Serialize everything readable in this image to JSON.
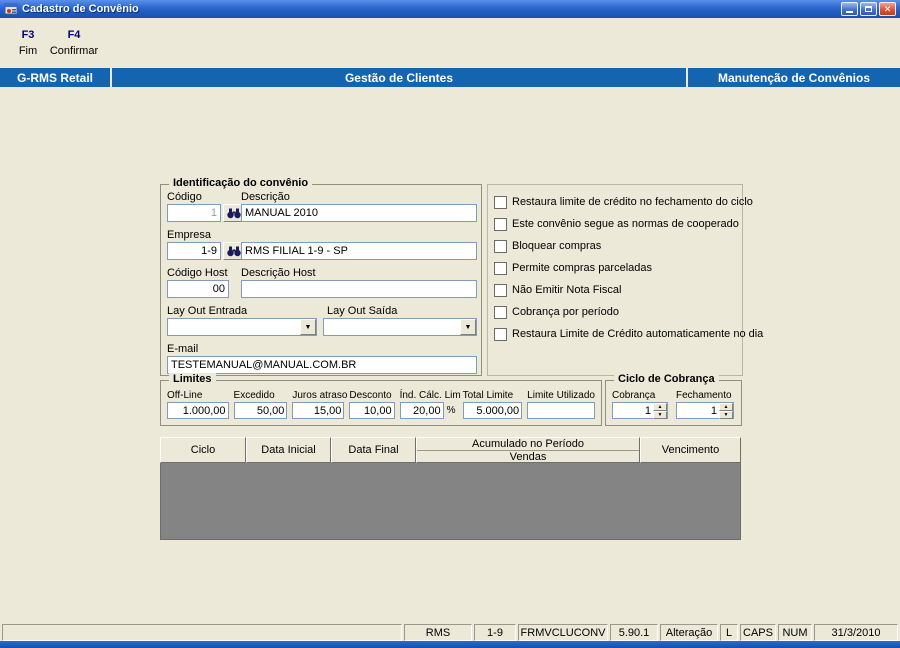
{
  "colors": {
    "header_blue": "#1464AF",
    "titlebar_blue": "#2A66CC",
    "grid_body_gray": "#848484",
    "form_bg": "#ECE9D8"
  },
  "window": {
    "title": "Cadastro de Convênio"
  },
  "toolbar": {
    "items": [
      {
        "key": "F3",
        "label": "Fim"
      },
      {
        "key": "F4",
        "label": "Confirmar"
      }
    ]
  },
  "header": {
    "left": "G-RMS Retail",
    "center": "Gestão de Clientes",
    "right": "Manutenção de Convênios"
  },
  "identification": {
    "title": "Identificação do convênio",
    "codigo": {
      "label": "Código",
      "value": "1"
    },
    "descricao": {
      "label": "Descrição",
      "value": "MANUAL 2010"
    },
    "empresa": {
      "label": "Empresa",
      "value": "1-9",
      "descricao": "RMS FILIAL 1-9 - SP"
    },
    "codigo_host": {
      "label": "Código Host",
      "value": "00"
    },
    "descricao_host": {
      "label": "Descrição Host",
      "value": ""
    },
    "layout_entrada": {
      "label": "Lay Out Entrada",
      "value": ""
    },
    "layout_saida": {
      "label": "Lay Out Saída",
      "value": ""
    },
    "email": {
      "label": "E-mail",
      "value": "TESTEMANUAL@MANUAL.COM.BR"
    }
  },
  "options": {
    "items": [
      {
        "label": "Restaura limite de crédito no fechamento do ciclo",
        "checked": false
      },
      {
        "label": "Este convênio segue as normas de cooperado",
        "checked": false
      },
      {
        "label": "Bloquear compras",
        "checked": false
      },
      {
        "label": "Permite compras parceladas",
        "checked": false
      },
      {
        "label": "Não Emitir Nota Fiscal",
        "checked": false
      },
      {
        "label": "Cobrança por período",
        "checked": false
      },
      {
        "label": "Restaura Limite de Crédito automaticamente no dia",
        "checked": false
      }
    ]
  },
  "limites": {
    "title": "Limites",
    "fields": [
      {
        "label": "Off-Line",
        "value": "1.000,00"
      },
      {
        "label": "Excedido",
        "value": "50,00"
      },
      {
        "label": "Juros atraso",
        "value": "15,00"
      },
      {
        "label": "Desconto",
        "value": "10,00"
      },
      {
        "label": "Índ. Cálc. Lim",
        "value": "20,00",
        "suffix": "%"
      },
      {
        "label": "Total Limite",
        "value": "5.000,00"
      },
      {
        "label": "Limite Utilizado",
        "value": ""
      }
    ]
  },
  "ciclo_cobranca": {
    "title": "Ciclo de Cobrança",
    "cobranca": {
      "label": "Cobrança",
      "value": "1"
    },
    "fechamento": {
      "label": "Fechamento",
      "value": "1"
    }
  },
  "table": {
    "headers": [
      "Ciclo",
      "Data Inicial",
      "Data Final",
      "Vencimento"
    ],
    "group_header": {
      "top": "Acumulado no Período",
      "bottom": "Vendas"
    },
    "rows": []
  },
  "statusbar": {
    "items": [
      "RMS",
      "1-9",
      "FRMVCLUCONV",
      "5.90.1",
      "Alteração",
      "L",
      "CAPS",
      "NUM",
      "31/3/2010"
    ]
  }
}
